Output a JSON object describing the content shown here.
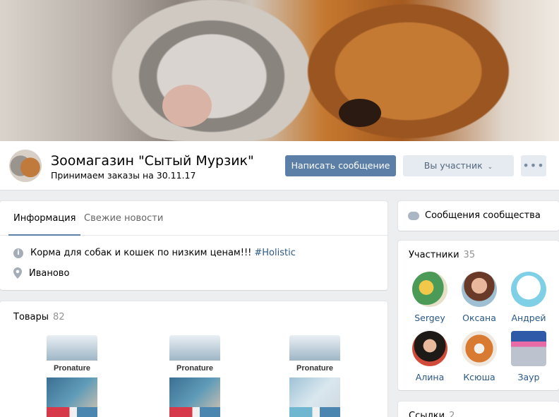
{
  "group": {
    "name": "Зоомагазин \"Сытый Мурзик\"",
    "status": "Принимаем заказы на 30.11.17"
  },
  "actions": {
    "message_label": "Написать сообщение",
    "member_label": "Вы участник",
    "more_label": "•••"
  },
  "tabs": [
    {
      "label": "Информация"
    },
    {
      "label": "Свежие новости"
    }
  ],
  "info": {
    "description": "Корма для собак и кошек по низким ценам!!!",
    "hashtag": "#Holistic",
    "city": "Иваново"
  },
  "goods": {
    "title": "Товары",
    "count": "82",
    "brand": "Pronature"
  },
  "community_messages": {
    "label": "Сообщения сообщества"
  },
  "members": {
    "title": "Участники",
    "count": "35",
    "list": [
      {
        "name": "Sergey"
      },
      {
        "name": "Оксана"
      },
      {
        "name": "Андрей"
      },
      {
        "name": "Алина"
      },
      {
        "name": "Ксюша"
      },
      {
        "name": "Заур"
      }
    ]
  },
  "links": {
    "title": "Ссылки",
    "count": "2"
  },
  "colors": {
    "primary_button": "#5b7fa6",
    "link": "#2a5885",
    "page_bg": "#edeef0"
  }
}
